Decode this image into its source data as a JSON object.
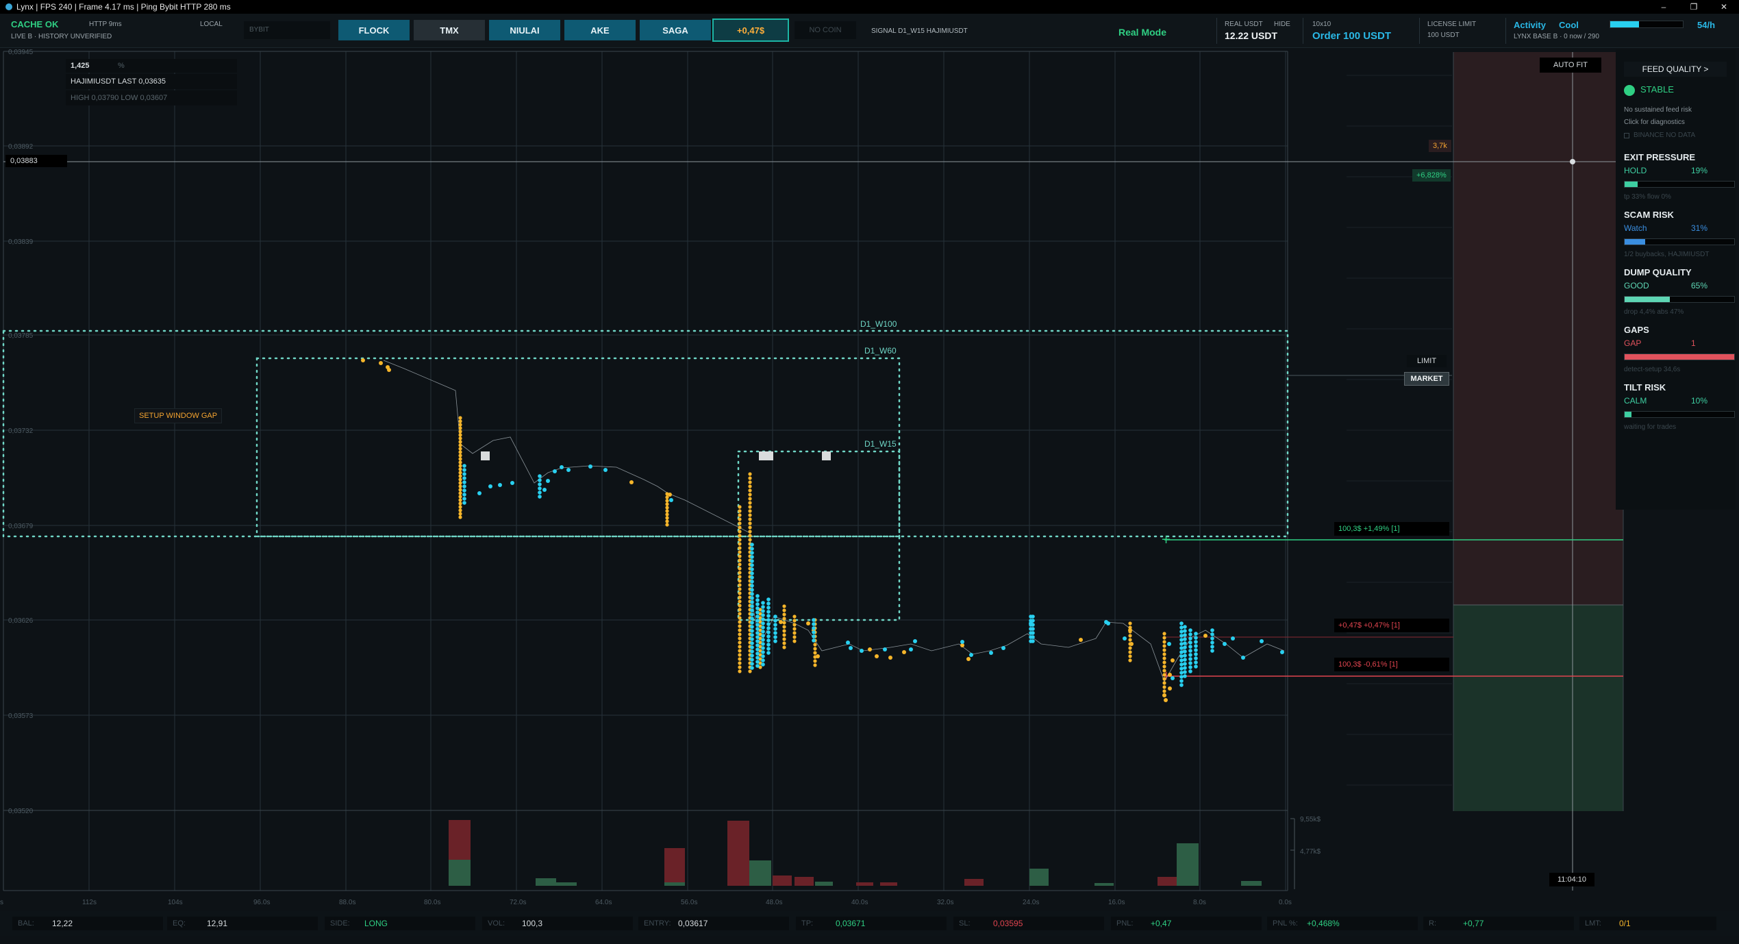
{
  "titlebar": {
    "text": "Lynx | FPS 240 | Frame 4.17 ms | Ping Bybit HTTP 280 ms",
    "minimize": "–",
    "maximize": "❐",
    "close": "✕"
  },
  "status": {
    "cache": "CACHE OK",
    "http": "HTTP 9ms",
    "local": "LOCAL",
    "history": "LIVE B · HISTORY UNVERIFIED"
  },
  "exchange": {
    "input_value": "BYBIT"
  },
  "symbols": [
    "FLOCK",
    "TMX",
    "NIULAI",
    "AKE",
    "SAGA"
  ],
  "pnl_pill": "+0,47$",
  "no_coin": "NO COIN",
  "signal": "SIGNAL D1_W15 HAJIMIUSDT",
  "mode": "Real Mode",
  "real_usdt": {
    "label": "REAL USDT",
    "hide": "HIDE",
    "value": "12.22 USDT"
  },
  "order": {
    "leverage": "10x10",
    "label": "Order 100 USDT"
  },
  "license": {
    "label": "LICENSE LIMIT",
    "value": "100 USDT"
  },
  "activity": {
    "label": "Activity",
    "state": "Cool",
    "rate": "54/h",
    "progress": 0.4,
    "base": "LYNX BASE B · 0 now / 290"
  },
  "chart": {
    "zoom": "1,425",
    "zoom_unit": "%",
    "info_line1": "HAJIMIUSDT  LAST 0,03635",
    "info_line2": "HIGH 0,03790  LOW 0,03607",
    "crosshair_price": "0,03883",
    "y_labels": [
      "0,03945",
      "0,03892",
      "0,03839",
      "0,03785",
      "0,03732",
      "0,03679",
      "0,03626",
      "0,03573",
      "0,03520"
    ],
    "x_labels": [
      "s",
      "112s",
      "104s",
      "96.0s",
      "88.0s",
      "80.0s",
      "72.0s",
      "64.0s",
      "56.0s",
      "48.0s",
      "40.0s",
      "32.0s",
      "24.0s",
      "16.0s",
      "8.0s",
      "0.0s"
    ],
    "windows": [
      "D1_W100",
      "D1_W60",
      "D1_W15"
    ],
    "setup_gap": "SETUP WINDOW GAP",
    "volume_labels": [
      "9,55k$",
      "4,77k$"
    ],
    "auto_fit": "AUTO FIT",
    "time": "11:04:10",
    "depth_label": "3,7k",
    "change_label": "+6,828%",
    "limit": "LIMIT",
    "market": "MARKET",
    "tp_line": "100,3$  +1,49% [1]",
    "entry_line": "+0,47$  +0,47% [1]",
    "sl_line": "100,3$  -0,61% [1]",
    "colors": {
      "buy": "#29d0f0",
      "sell": "#f5b52a",
      "tp": "#2fcf83",
      "sl": "#e0444f",
      "window": "#6fd6c6"
    }
  },
  "panel": {
    "feed_quality": "FEED QUALITY  >",
    "feed_status": "STABLE",
    "feed_line1": "No sustained feed risk",
    "feed_line2": "Click for diagnostics",
    "binance": "BINANCE NO DATA",
    "metrics": [
      {
        "title": "EXIT PRESSURE",
        "state": "HOLD",
        "pct": "19%",
        "fill": 0.12,
        "color": "#3ecfa2",
        "sub": "tp 33%  flow 0%"
      },
      {
        "title": "SCAM RISK",
        "state": "Watch",
        "pct": "31%",
        "fill": 0.19,
        "color": "#3a8ee0",
        "sub": "1/2 buybacks, HAJIMIUSDT"
      },
      {
        "title": "DUMP QUALITY",
        "state": "GOOD",
        "pct": "65%",
        "fill": 0.41,
        "color": "#5ed6b4",
        "sub": "drop 4,4%  abs 47%"
      },
      {
        "title": "GAPS",
        "state": "GAP",
        "pct": "1",
        "fill": 1.0,
        "color": "#e0525c",
        "sub": "detect-setup  34,6s"
      },
      {
        "title": "TILT RISK",
        "state": "CALM",
        "pct": "10%",
        "fill": 0.06,
        "color": "#3ecfa2",
        "sub": "waiting for trades"
      }
    ]
  },
  "bottom": [
    {
      "k": "BAL:",
      "v": "12,22",
      "c": "#d6dbde"
    },
    {
      "k": "EQ:",
      "v": "12,91",
      "c": "#d6dbde"
    },
    {
      "k": "SIDE:",
      "v": "LONG",
      "c": "#2fcf83"
    },
    {
      "k": "VOL:",
      "v": "100,3",
      "c": "#d6dbde"
    },
    {
      "k": "ENTRY:",
      "v": "0,03617",
      "c": "#d6dbde"
    },
    {
      "k": "TP:",
      "v": "0,03671",
      "c": "#2fcf83"
    },
    {
      "k": "SL:",
      "v": "0,03595",
      "c": "#e0444f"
    },
    {
      "k": "PNL:",
      "v": "+0,47",
      "c": "#2fcf83"
    },
    {
      "k": "PNL %:",
      "v": "+0,468%",
      "c": "#2fcf83"
    },
    {
      "k": "R:",
      "v": "+0,77",
      "c": "#2fcf83"
    },
    {
      "k": "LMT:",
      "v": "0/1",
      "c": "#f5b52a"
    }
  ]
}
